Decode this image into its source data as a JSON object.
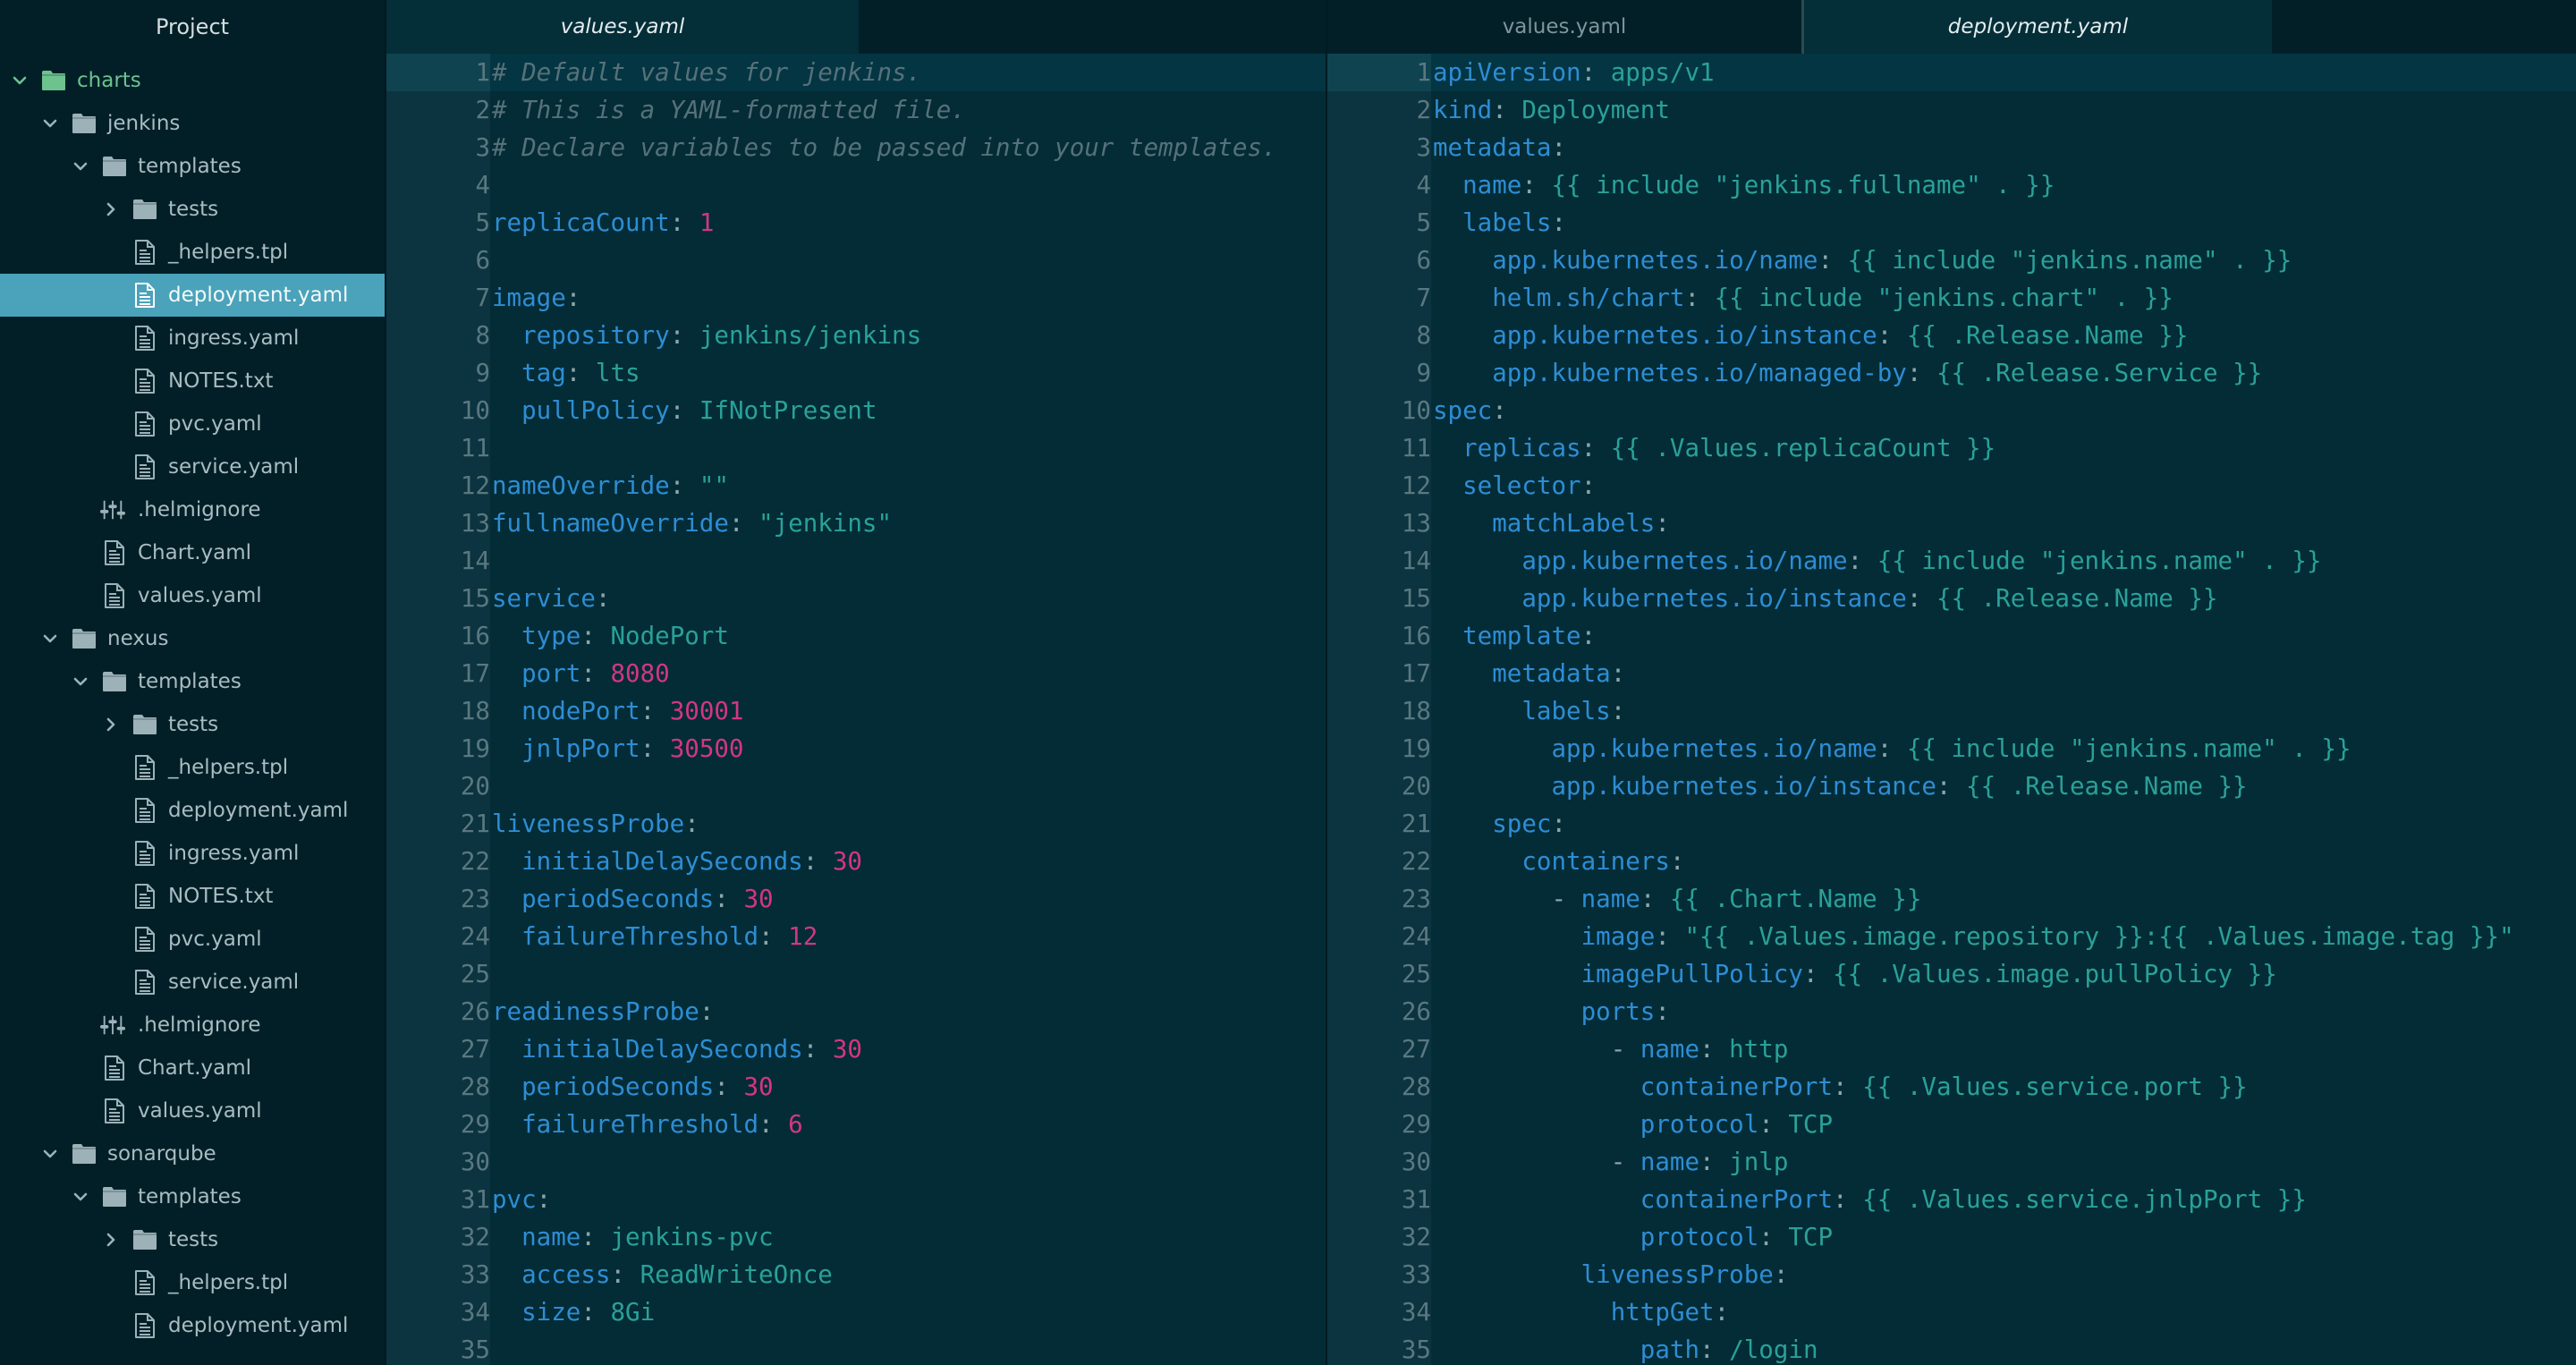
{
  "sidebar": {
    "title": "Project",
    "colors": {
      "selected_bg": "#4aa3ba",
      "root_folder": "#6cc38e",
      "folder": "#9cb2b8"
    },
    "items": [
      {
        "label": "charts",
        "type": "folder",
        "depth": 0,
        "expanded": true,
        "root": true
      },
      {
        "label": "jenkins",
        "type": "folder",
        "depth": 1,
        "expanded": true
      },
      {
        "label": "templates",
        "type": "folder",
        "depth": 2,
        "expanded": true
      },
      {
        "label": "tests",
        "type": "folder",
        "depth": 3,
        "expanded": false
      },
      {
        "label": "_helpers.tpl",
        "type": "file",
        "depth": 3
      },
      {
        "label": "deployment.yaml",
        "type": "file",
        "depth": 3,
        "selected": true
      },
      {
        "label": "ingress.yaml",
        "type": "file",
        "depth": 3
      },
      {
        "label": "NOTES.txt",
        "type": "file",
        "depth": 3
      },
      {
        "label": "pvc.yaml",
        "type": "file",
        "depth": 3
      },
      {
        "label": "service.yaml",
        "type": "file",
        "depth": 3
      },
      {
        "label": ".helmignore",
        "type": "ignore",
        "depth": 2
      },
      {
        "label": "Chart.yaml",
        "type": "file",
        "depth": 2
      },
      {
        "label": "values.yaml",
        "type": "file",
        "depth": 2
      },
      {
        "label": "nexus",
        "type": "folder",
        "depth": 1,
        "expanded": true
      },
      {
        "label": "templates",
        "type": "folder",
        "depth": 2,
        "expanded": true
      },
      {
        "label": "tests",
        "type": "folder",
        "depth": 3,
        "expanded": false
      },
      {
        "label": "_helpers.tpl",
        "type": "file",
        "depth": 3
      },
      {
        "label": "deployment.yaml",
        "type": "file",
        "depth": 3
      },
      {
        "label": "ingress.yaml",
        "type": "file",
        "depth": 3
      },
      {
        "label": "NOTES.txt",
        "type": "file",
        "depth": 3
      },
      {
        "label": "pvc.yaml",
        "type": "file",
        "depth": 3
      },
      {
        "label": "service.yaml",
        "type": "file",
        "depth": 3
      },
      {
        "label": ".helmignore",
        "type": "ignore",
        "depth": 2
      },
      {
        "label": "Chart.yaml",
        "type": "file",
        "depth": 2
      },
      {
        "label": "values.yaml",
        "type": "file",
        "depth": 2
      },
      {
        "label": "sonarqube",
        "type": "folder",
        "depth": 1,
        "expanded": true
      },
      {
        "label": "templates",
        "type": "folder",
        "depth": 2,
        "expanded": true
      },
      {
        "label": "tests",
        "type": "folder",
        "depth": 3,
        "expanded": false
      },
      {
        "label": "_helpers.tpl",
        "type": "file",
        "depth": 3
      },
      {
        "label": "deployment.yaml",
        "type": "file",
        "depth": 3
      }
    ]
  },
  "panes": [
    {
      "id": "left",
      "tabs": [
        {
          "label": "values.yaml",
          "active": true
        }
      ],
      "current_line": 1,
      "lines": [
        [
          [
            "com",
            "# Default values for jenkins."
          ]
        ],
        [
          [
            "com",
            "# This is a YAML-formatted file."
          ]
        ],
        [
          [
            "com",
            "# Declare variables to be passed into your templates."
          ]
        ],
        [],
        [
          [
            "key",
            "replicaCount"
          ],
          [
            "pun",
            ": "
          ],
          [
            "num",
            "1"
          ]
        ],
        [],
        [
          [
            "key",
            "image"
          ],
          [
            "pun",
            ":"
          ]
        ],
        [
          [
            "sp",
            "  "
          ],
          [
            "key",
            "repository"
          ],
          [
            "pun",
            ": "
          ],
          [
            "str",
            "jenkins/jenkins"
          ]
        ],
        [
          [
            "sp",
            "  "
          ],
          [
            "key",
            "tag"
          ],
          [
            "pun",
            ": "
          ],
          [
            "str",
            "lts"
          ]
        ],
        [
          [
            "sp",
            "  "
          ],
          [
            "key",
            "pullPolicy"
          ],
          [
            "pun",
            ": "
          ],
          [
            "str",
            "IfNotPresent"
          ]
        ],
        [],
        [
          [
            "key",
            "nameOverride"
          ],
          [
            "pun",
            ": "
          ],
          [
            "str",
            "\"\""
          ]
        ],
        [
          [
            "key",
            "fullnameOverride"
          ],
          [
            "pun",
            ": "
          ],
          [
            "str",
            "\"jenkins\""
          ]
        ],
        [],
        [
          [
            "key",
            "service"
          ],
          [
            "pun",
            ":"
          ]
        ],
        [
          [
            "sp",
            "  "
          ],
          [
            "key",
            "type"
          ],
          [
            "pun",
            ": "
          ],
          [
            "str",
            "NodePort"
          ]
        ],
        [
          [
            "sp",
            "  "
          ],
          [
            "key",
            "port"
          ],
          [
            "pun",
            ": "
          ],
          [
            "num",
            "8080"
          ]
        ],
        [
          [
            "sp",
            "  "
          ],
          [
            "key",
            "nodePort"
          ],
          [
            "pun",
            ": "
          ],
          [
            "num",
            "30001"
          ]
        ],
        [
          [
            "sp",
            "  "
          ],
          [
            "key",
            "jnlpPort"
          ],
          [
            "pun",
            ": "
          ],
          [
            "num",
            "30500"
          ]
        ],
        [],
        [
          [
            "key",
            "livenessProbe"
          ],
          [
            "pun",
            ":"
          ]
        ],
        [
          [
            "sp",
            "  "
          ],
          [
            "key",
            "initialDelaySeconds"
          ],
          [
            "pun",
            ": "
          ],
          [
            "num",
            "30"
          ]
        ],
        [
          [
            "sp",
            "  "
          ],
          [
            "key",
            "periodSeconds"
          ],
          [
            "pun",
            ": "
          ],
          [
            "num",
            "30"
          ]
        ],
        [
          [
            "sp",
            "  "
          ],
          [
            "key",
            "failureThreshold"
          ],
          [
            "pun",
            ": "
          ],
          [
            "num",
            "12"
          ]
        ],
        [],
        [
          [
            "key",
            "readinessProbe"
          ],
          [
            "pun",
            ":"
          ]
        ],
        [
          [
            "sp",
            "  "
          ],
          [
            "key",
            "initialDelaySeconds"
          ],
          [
            "pun",
            ": "
          ],
          [
            "num",
            "30"
          ]
        ],
        [
          [
            "sp",
            "  "
          ],
          [
            "key",
            "periodSeconds"
          ],
          [
            "pun",
            ": "
          ],
          [
            "num",
            "30"
          ]
        ],
        [
          [
            "sp",
            "  "
          ],
          [
            "key",
            "failureThreshold"
          ],
          [
            "pun",
            ": "
          ],
          [
            "num",
            "6"
          ]
        ],
        [],
        [
          [
            "key",
            "pvc"
          ],
          [
            "pun",
            ":"
          ]
        ],
        [
          [
            "sp",
            "  "
          ],
          [
            "key",
            "name"
          ],
          [
            "pun",
            ": "
          ],
          [
            "str",
            "jenkins-pvc"
          ]
        ],
        [
          [
            "sp",
            "  "
          ],
          [
            "key",
            "access"
          ],
          [
            "pun",
            ": "
          ],
          [
            "str",
            "ReadWriteOnce"
          ]
        ],
        [
          [
            "sp",
            "  "
          ],
          [
            "key",
            "size"
          ],
          [
            "pun",
            ": "
          ],
          [
            "str",
            "8Gi"
          ]
        ],
        []
      ]
    },
    {
      "id": "right",
      "tabs": [
        {
          "label": "values.yaml",
          "active": false
        },
        {
          "label": "deployment.yaml",
          "active": true
        }
      ],
      "current_line": 1,
      "lines": [
        [
          [
            "key",
            "apiVersion"
          ],
          [
            "pun",
            ": "
          ],
          [
            "str",
            "apps/v1"
          ]
        ],
        [
          [
            "key",
            "kind"
          ],
          [
            "pun",
            ": "
          ],
          [
            "str",
            "Deployment"
          ]
        ],
        [
          [
            "key",
            "metadata"
          ],
          [
            "pun",
            ":"
          ]
        ],
        [
          [
            "sp",
            "  "
          ],
          [
            "key",
            "name"
          ],
          [
            "pun",
            ": "
          ],
          [
            "str",
            "{{ include \"jenkins.fullname\" . }}"
          ]
        ],
        [
          [
            "sp",
            "  "
          ],
          [
            "key",
            "labels"
          ],
          [
            "pun",
            ":"
          ]
        ],
        [
          [
            "sp",
            "    "
          ],
          [
            "key",
            "app.kubernetes.io/name"
          ],
          [
            "pun",
            ": "
          ],
          [
            "str",
            "{{ include \"jenkins.name\" . }}"
          ]
        ],
        [
          [
            "sp",
            "    "
          ],
          [
            "key",
            "helm.sh/chart"
          ],
          [
            "pun",
            ": "
          ],
          [
            "str",
            "{{ include \"jenkins.chart\" . }}"
          ]
        ],
        [
          [
            "sp",
            "    "
          ],
          [
            "key",
            "app.kubernetes.io/instance"
          ],
          [
            "pun",
            ": "
          ],
          [
            "str",
            "{{ .Release.Name }}"
          ]
        ],
        [
          [
            "sp",
            "    "
          ],
          [
            "key",
            "app.kubernetes.io/managed-by"
          ],
          [
            "pun",
            ": "
          ],
          [
            "str",
            "{{ .Release.Service }}"
          ]
        ],
        [
          [
            "key",
            "spec"
          ],
          [
            "pun",
            ":"
          ]
        ],
        [
          [
            "sp",
            "  "
          ],
          [
            "key",
            "replicas"
          ],
          [
            "pun",
            ": "
          ],
          [
            "str",
            "{{ .Values.replicaCount }}"
          ]
        ],
        [
          [
            "sp",
            "  "
          ],
          [
            "key",
            "selector"
          ],
          [
            "pun",
            ":"
          ]
        ],
        [
          [
            "sp",
            "    "
          ],
          [
            "key",
            "matchLabels"
          ],
          [
            "pun",
            ":"
          ]
        ],
        [
          [
            "sp",
            "      "
          ],
          [
            "key",
            "app.kubernetes.io/name"
          ],
          [
            "pun",
            ": "
          ],
          [
            "str",
            "{{ include \"jenkins.name\" . }}"
          ]
        ],
        [
          [
            "sp",
            "      "
          ],
          [
            "key",
            "app.kubernetes.io/instance"
          ],
          [
            "pun",
            ": "
          ],
          [
            "str",
            "{{ .Release.Name }}"
          ]
        ],
        [
          [
            "sp",
            "  "
          ],
          [
            "key",
            "template"
          ],
          [
            "pun",
            ":"
          ]
        ],
        [
          [
            "sp",
            "    "
          ],
          [
            "key",
            "metadata"
          ],
          [
            "pun",
            ":"
          ]
        ],
        [
          [
            "sp",
            "      "
          ],
          [
            "key",
            "labels"
          ],
          [
            "pun",
            ":"
          ]
        ],
        [
          [
            "sp",
            "        "
          ],
          [
            "key",
            "app.kubernetes.io/name"
          ],
          [
            "pun",
            ": "
          ],
          [
            "str",
            "{{ include \"jenkins.name\" . }}"
          ]
        ],
        [
          [
            "sp",
            "        "
          ],
          [
            "key",
            "app.kubernetes.io/instance"
          ],
          [
            "pun",
            ": "
          ],
          [
            "str",
            "{{ .Release.Name }}"
          ]
        ],
        [
          [
            "sp",
            "    "
          ],
          [
            "key",
            "spec"
          ],
          [
            "pun",
            ":"
          ]
        ],
        [
          [
            "sp",
            "      "
          ],
          [
            "key",
            "containers"
          ],
          [
            "pun",
            ":"
          ]
        ],
        [
          [
            "sp",
            "        "
          ],
          [
            "dash",
            "- "
          ],
          [
            "key",
            "name"
          ],
          [
            "pun",
            ": "
          ],
          [
            "str",
            "{{ .Chart.Name }}"
          ]
        ],
        [
          [
            "sp",
            "          "
          ],
          [
            "key",
            "image"
          ],
          [
            "pun",
            ": "
          ],
          [
            "str",
            "\"{{ .Values.image.repository }}:{{ .Values.image.tag }}\""
          ]
        ],
        [
          [
            "sp",
            "          "
          ],
          [
            "key",
            "imagePullPolicy"
          ],
          [
            "pun",
            ": "
          ],
          [
            "str",
            "{{ .Values.image.pullPolicy }}"
          ]
        ],
        [
          [
            "sp",
            "          "
          ],
          [
            "key",
            "ports"
          ],
          [
            "pun",
            ":"
          ]
        ],
        [
          [
            "sp",
            "            "
          ],
          [
            "dash",
            "- "
          ],
          [
            "key",
            "name"
          ],
          [
            "pun",
            ": "
          ],
          [
            "str",
            "http"
          ]
        ],
        [
          [
            "sp",
            "              "
          ],
          [
            "key",
            "containerPort"
          ],
          [
            "pun",
            ": "
          ],
          [
            "str",
            "{{ .Values.service.port }}"
          ]
        ],
        [
          [
            "sp",
            "              "
          ],
          [
            "key",
            "protocol"
          ],
          [
            "pun",
            ": "
          ],
          [
            "str",
            "TCP"
          ]
        ],
        [
          [
            "sp",
            "            "
          ],
          [
            "dash",
            "- "
          ],
          [
            "key",
            "name"
          ],
          [
            "pun",
            ": "
          ],
          [
            "str",
            "jnlp"
          ]
        ],
        [
          [
            "sp",
            "              "
          ],
          [
            "key",
            "containerPort"
          ],
          [
            "pun",
            ": "
          ],
          [
            "str",
            "{{ .Values.service.jnlpPort }}"
          ]
        ],
        [
          [
            "sp",
            "              "
          ],
          [
            "key",
            "protocol"
          ],
          [
            "pun",
            ": "
          ],
          [
            "str",
            "TCP"
          ]
        ],
        [
          [
            "sp",
            "          "
          ],
          [
            "key",
            "livenessProbe"
          ],
          [
            "pun",
            ":"
          ]
        ],
        [
          [
            "sp",
            "            "
          ],
          [
            "key",
            "httpGet"
          ],
          [
            "pun",
            ":"
          ]
        ],
        [
          [
            "sp",
            "              "
          ],
          [
            "key",
            "path"
          ],
          [
            "pun",
            ": "
          ],
          [
            "str",
            "/login"
          ]
        ]
      ]
    }
  ],
  "syntax_colors": {
    "key": "#2e8dd4",
    "punctuation": "#8ea5aa",
    "string": "#2aa198",
    "number": "#d33682",
    "comment": "#56717a"
  }
}
